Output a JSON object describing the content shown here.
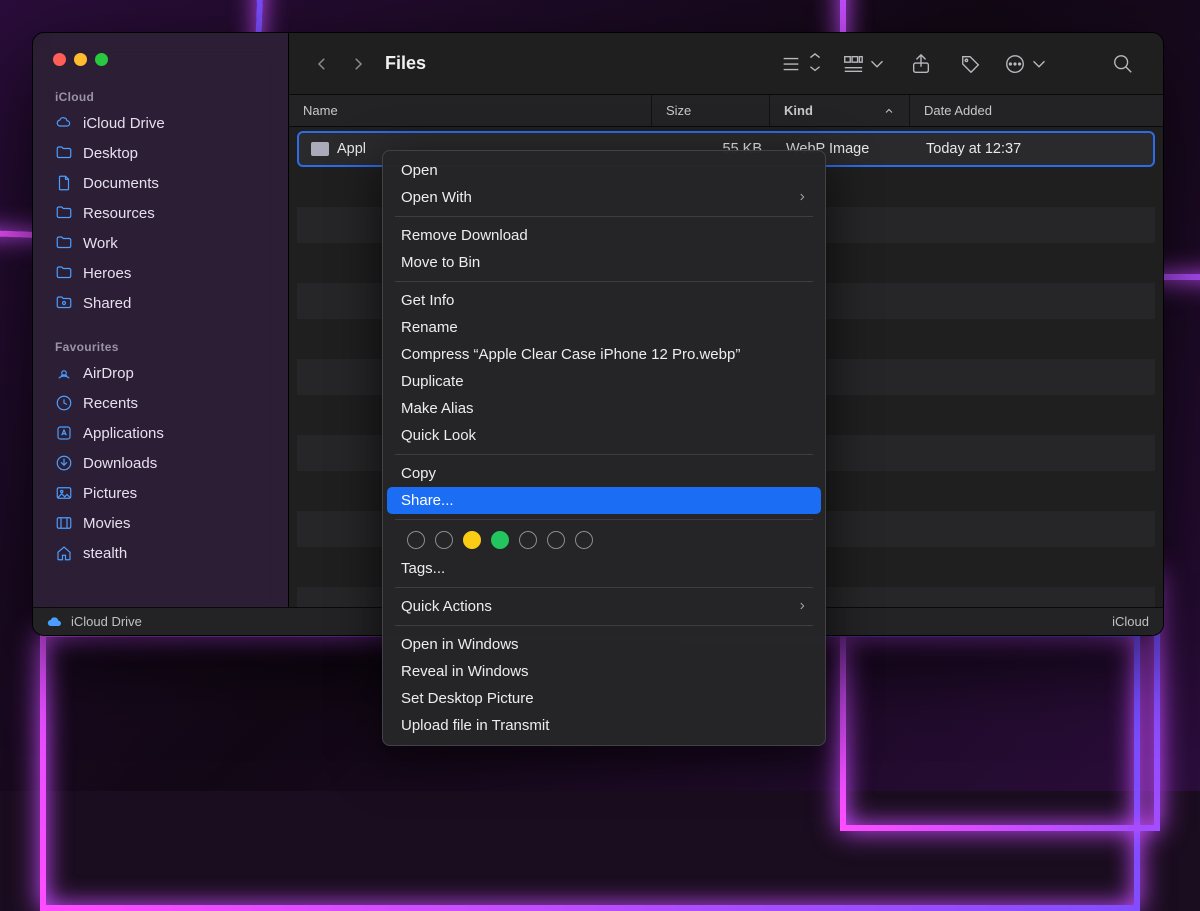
{
  "window_title": "Files",
  "sidebar": {
    "sections": [
      {
        "title": "iCloud",
        "items": [
          {
            "name": "icloud-drive",
            "label": "iCloud Drive",
            "icon": "cloud"
          },
          {
            "name": "desktop",
            "label": "Desktop",
            "icon": "folder"
          },
          {
            "name": "documents",
            "label": "Documents",
            "icon": "doc"
          },
          {
            "name": "resources",
            "label": "Resources",
            "icon": "folder"
          },
          {
            "name": "work",
            "label": "Work",
            "icon": "folder"
          },
          {
            "name": "heroes",
            "label": "Heroes",
            "icon": "folder"
          },
          {
            "name": "shared",
            "label": "Shared",
            "icon": "sfolder"
          }
        ]
      },
      {
        "title": "Favourites",
        "items": [
          {
            "name": "airdrop",
            "label": "AirDrop",
            "icon": "airdrop"
          },
          {
            "name": "recents",
            "label": "Recents",
            "icon": "clock"
          },
          {
            "name": "applications",
            "label": "Applications",
            "icon": "app"
          },
          {
            "name": "downloads",
            "label": "Downloads",
            "icon": "download"
          },
          {
            "name": "pictures",
            "label": "Pictures",
            "icon": "image"
          },
          {
            "name": "movies",
            "label": "Movies",
            "icon": "movie"
          },
          {
            "name": "stealth",
            "label": "stealth",
            "icon": "home"
          }
        ]
      }
    ]
  },
  "columns": {
    "name": "Name",
    "size": "Size",
    "kind": "Kind",
    "date": "Date Added"
  },
  "selected_row": {
    "filename": "Apple Clear Case iPhone 12 Pro.webp",
    "filename_visible_prefix": "Appl",
    "size": "55 KB",
    "kind": "WebP Image",
    "date_added": "Today at 12:37"
  },
  "pathbar": {
    "start": "iCloud Drive",
    "end": "iCloud"
  },
  "context_menu": {
    "groups": [
      [
        {
          "label": "Open"
        },
        {
          "label": "Open With",
          "submenu": true
        }
      ],
      [
        {
          "label": "Remove Download"
        },
        {
          "label": "Move to Bin"
        }
      ],
      [
        {
          "label": "Get Info"
        },
        {
          "label": "Rename"
        },
        {
          "label": "Compress “Apple Clear Case iPhone 12 Pro.webp”"
        },
        {
          "label": "Duplicate"
        },
        {
          "label": "Make Alias"
        },
        {
          "label": "Quick Look"
        }
      ],
      [
        {
          "label": "Copy"
        },
        {
          "label": "Share...",
          "highlight": true
        }
      ],
      [
        {
          "colors": true
        },
        {
          "label": "Tags..."
        }
      ],
      [
        {
          "label": "Quick Actions",
          "submenu": true
        }
      ],
      [
        {
          "label": "Open in Windows"
        },
        {
          "label": "Reveal in Windows"
        },
        {
          "label": "Set Desktop Picture"
        },
        {
          "label": "Upload file in Transmit"
        }
      ]
    ]
  }
}
